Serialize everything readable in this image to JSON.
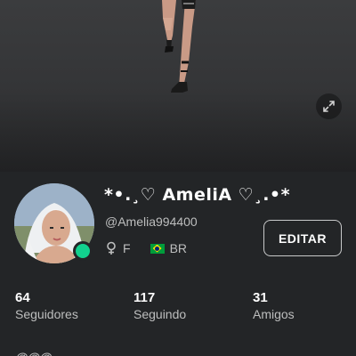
{
  "profile": {
    "display_name": "*•.¸♡ AmeliA ♡¸.•*",
    "username": "@Amelia994400",
    "gender": "F",
    "country": "BR",
    "online": true
  },
  "actions": {
    "edit_label": "EDITAR"
  },
  "stats": [
    {
      "value": "64",
      "label": "Seguidores"
    },
    {
      "value": "117",
      "label": "Seguindo"
    },
    {
      "value": "31",
      "label": "Amigos"
    }
  ],
  "icons": {
    "expand": "expand-icon",
    "gender": "female-symbol-icon",
    "flag": "brazil-flag-icon"
  },
  "colors": {
    "background": "#232527",
    "online_indicator": "#12d18e",
    "secondary_text": "#bdbebe"
  },
  "footer": {
    "cut_text": "@@@"
  }
}
